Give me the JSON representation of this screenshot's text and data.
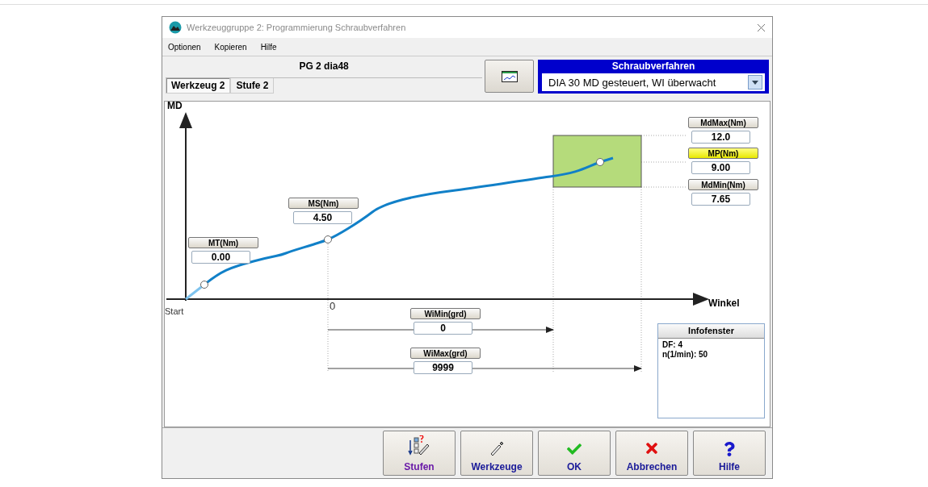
{
  "window": {
    "title": "Werkzeuggruppe 2: Programmierung Schraubverfahren"
  },
  "menu": [
    "Optionen",
    "Kopieren",
    "Hilfe"
  ],
  "header": {
    "program": "PG 2  dia48",
    "tabs": [
      {
        "label": "Werkzeug 2",
        "selected": true
      },
      {
        "label": "Stufe 2",
        "selected": false
      }
    ]
  },
  "screw_method": {
    "title": "Schraubverfahren",
    "value": "DIA 30  MD gesteuert, WI überwacht"
  },
  "diagram": {
    "y_axis": "MD",
    "x_axis": "Winkel",
    "start": "Start",
    "zero": "0",
    "torque_params": [
      {
        "label": "MT(Nm)",
        "value": "0.00",
        "highlighted": false
      },
      {
        "label": "MS(Nm)",
        "value": "4.50",
        "highlighted": false
      },
      {
        "label": "MdMax(Nm)",
        "value": "12.0",
        "highlighted": false
      },
      {
        "label": "MP(Nm)",
        "value": "9.00",
        "highlighted": true
      },
      {
        "label": "MdMin(Nm)",
        "value": "7.65",
        "highlighted": false
      }
    ],
    "angle_params": [
      {
        "label": "WiMin(grd)",
        "value": "0"
      },
      {
        "label": "WiMax(grd)",
        "value": "9999"
      }
    ],
    "info": {
      "title": "Infofenster",
      "lines": [
        "DF: 4",
        "n(1/min): 50"
      ]
    }
  },
  "buttons": [
    {
      "label": "Stufen",
      "kind": "steps"
    },
    {
      "label": "Werkzeuge",
      "kind": "tools"
    },
    {
      "label": "OK",
      "kind": "ok"
    },
    {
      "label": "Abbrechen",
      "kind": "cancel"
    },
    {
      "label": "Hilfe",
      "kind": "help"
    }
  ]
}
